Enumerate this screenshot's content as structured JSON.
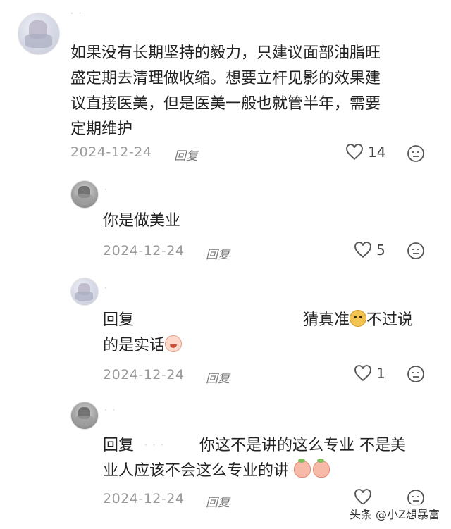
{
  "comment": {
    "lines": [
      "如果没有长期坚持的毅力，只建议面部油脂旺",
      "盛定期去清理做收缩。想要立杆见影的效果建",
      "议直接医美，但是医美一般也就管半年，需要",
      "定期维护"
    ],
    "date": "2024-12-24",
    "reply_label": "回复",
    "likes": "14"
  },
  "replies": [
    {
      "text_lines": [
        "你是做美业"
      ],
      "date": "2024-12-24",
      "reply_label": "回复",
      "likes": "5"
    },
    {
      "prefix": "回复",
      "line1_text": "猜真准",
      "line1_tail": "不过说",
      "line2_text": "的是实话",
      "date": "2024-12-24",
      "reply_label": "回复",
      "likes": "1"
    },
    {
      "prefix": "回复",
      "line1_text": "你这不是讲的这么专业 不是美",
      "line2_text": "业人应该不会这么专业的讲",
      "date": "2024-12-24",
      "reply_label": "回复",
      "likes": ""
    }
  ],
  "watermark": "头条 @小Z想暴富",
  "colors": {
    "text": "#222222",
    "meta": "#9a9a9a",
    "icon": "#555555"
  },
  "icons": [
    "heart-icon",
    "emoji-reaction-icon",
    "doge-emoji",
    "cry-laugh-emoji",
    "peach-emoji"
  ]
}
